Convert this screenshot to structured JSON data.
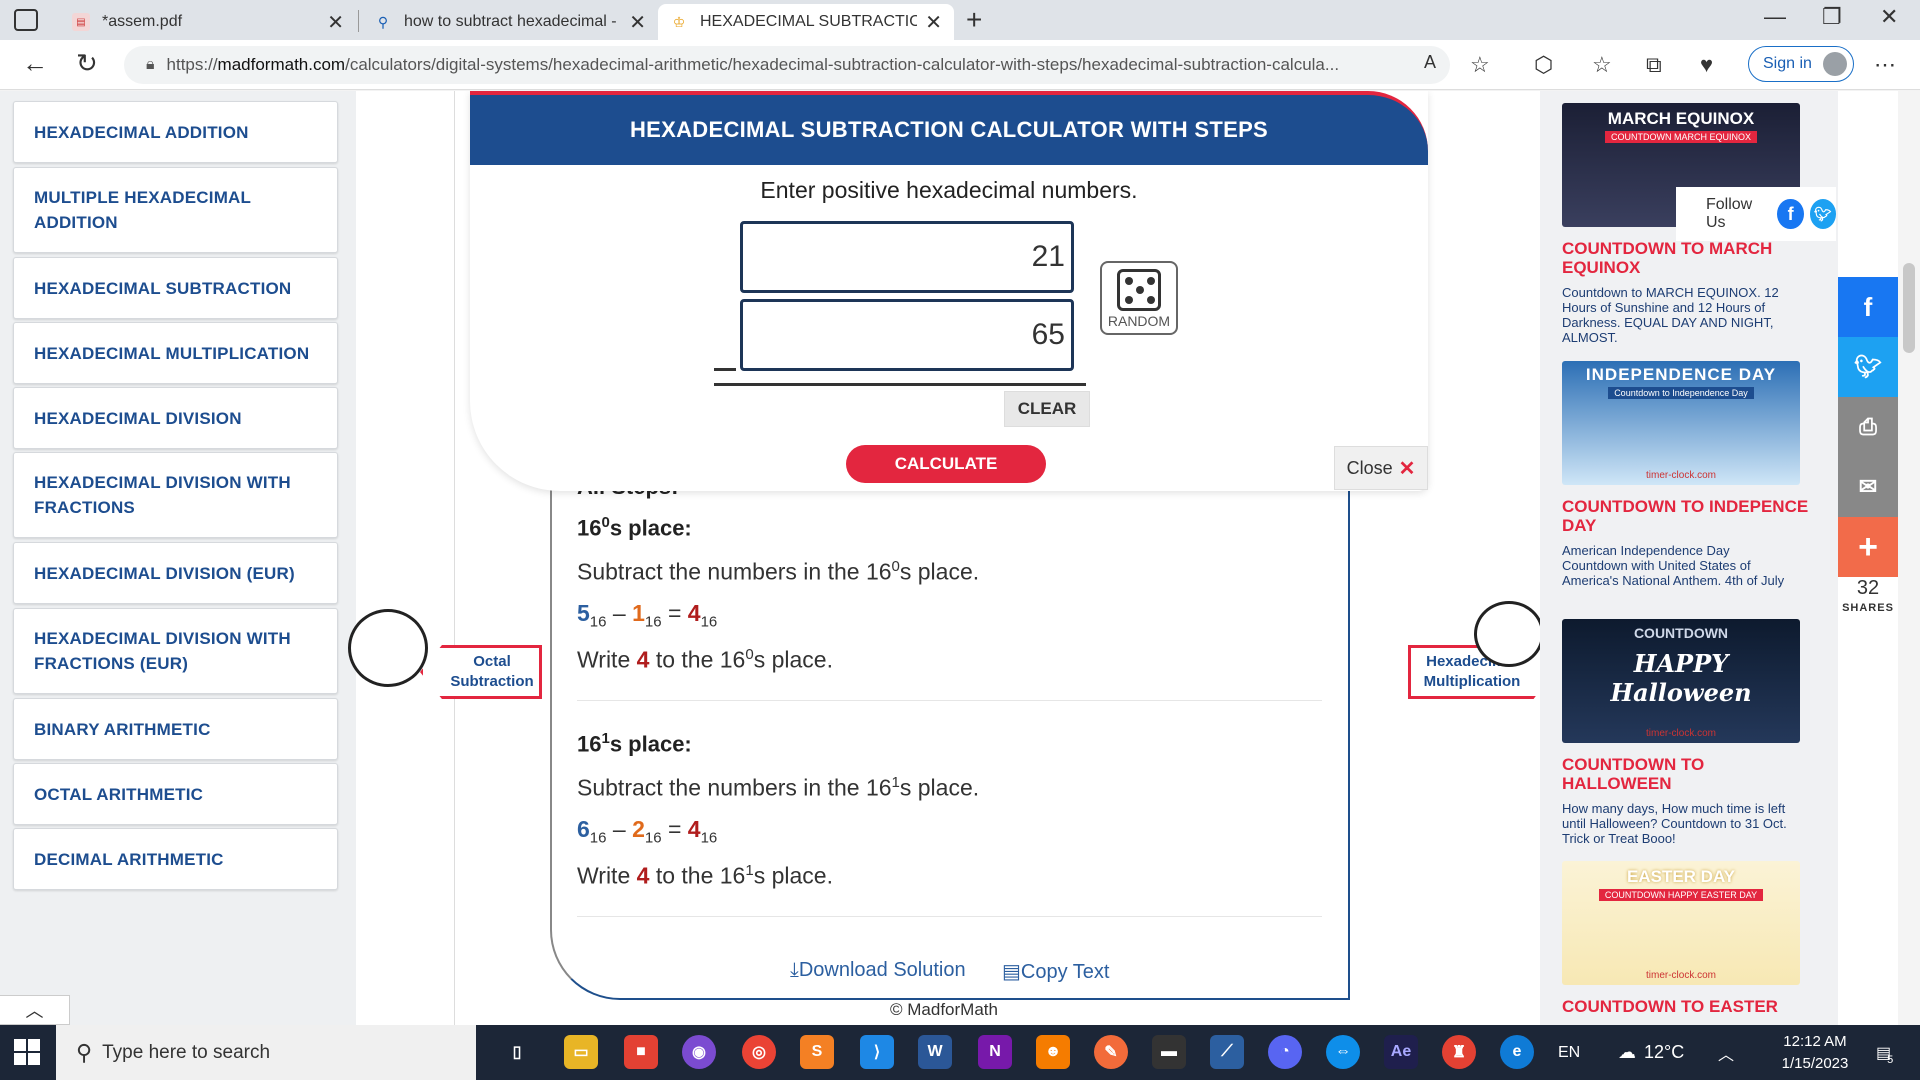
{
  "tabs": [
    {
      "title": "*assem.pdf",
      "icon": "pdf-icon"
    },
    {
      "title": "how to subtract hexadecimal - Se",
      "icon": "search-icon"
    },
    {
      "title": "HEXADECIMAL SUBTRACTION C/",
      "icon": "site-icon"
    }
  ],
  "address": {
    "prefix": "https://",
    "domain": "madformath.com",
    "path": "/calculators/digital-systems/hexadecimal-arithmetic/hexadecimal-subtraction-calculator-with-steps/hexadecimal-subtraction-calcula..."
  },
  "signin_label": "Sign in",
  "sidebar": {
    "items": [
      {
        "label": "HEXADECIMAL ADDITION"
      },
      {
        "label": "MULTIPLE HEXADECIMAL ADDITION"
      },
      {
        "label": "HEXADECIMAL SUBTRACTION"
      },
      {
        "label": "HEXADECIMAL MULTIPLICATION"
      },
      {
        "label": "HEXADECIMAL DIVISION"
      },
      {
        "label": "HEXADECIMAL DIVISION WITH FRACTIONS"
      },
      {
        "label": "HEXADECIMAL DIVISION (EUR)"
      },
      {
        "label": "HEXADECIMAL DIVISION WITH FRACTIONS (EUR)"
      },
      {
        "label": "BINARY ARITHMETIC"
      },
      {
        "label": "OCTAL ARITHMETIC"
      },
      {
        "label": "DECIMAL ARITHMETIC"
      }
    ]
  },
  "calculator": {
    "title": "HEXADECIMAL SUBTRACTION CALCULATOR WITH STEPS",
    "prompt": "Enter positive hexadecimal numbers.",
    "minuend": "21",
    "subtrahend": "65",
    "random_label": "RANDOM",
    "clear_label": "CLEAR",
    "calculate_label": "CALCULATE",
    "close_label": "Close"
  },
  "steps": {
    "partial_heading": "All Steps:",
    "places": [
      {
        "heading_base": "16",
        "exp": "0",
        "heading_tail": "s place:",
        "line1_pre": "Subtract the numbers in the 16",
        "line1_post": "s place.",
        "a": "5",
        "b": "1",
        "result": "4",
        "base": "16",
        "write_pre": "Write ",
        "write_digit": "4",
        "write_post_pre": " to the 16",
        "write_post": "s place."
      },
      {
        "heading_base": "16",
        "exp": "1",
        "heading_tail": "s place:",
        "line1_pre": "Subtract the numbers in the 16",
        "line1_post": "s place.",
        "a": "6",
        "b": "2",
        "result": "4",
        "base": "16",
        "write_pre": "Write ",
        "write_digit": "4",
        "write_post_pre": " to the 16",
        "write_post": "s place."
      }
    ],
    "minus_sign": "–",
    "equals_sign": "=",
    "download_label": "Download Solution",
    "copy_label": "Copy Text"
  },
  "mascots": {
    "left_label_1": "Octal",
    "left_label_2": "Subtraction",
    "right_label_1": "Hexadecimal",
    "right_label_2": "Multiplication"
  },
  "copyright": "© MadforMath",
  "follow_label": "Follow Us",
  "right_sidebar": {
    "ads": [
      {
        "title": "MARCH EQUINOX",
        "sub": "COUNTDOWN MARCH EQUINOX",
        "heading": "COUNTDOWN TO MARCH EQUINOX",
        "desc": "Countdown to MARCH EQUINOX. 12 Hours of Sunshine and 12 Hours of Darkness. EQUAL DAY AND NIGHT, ALMOST."
      },
      {
        "title": "INDEPENDENCE DAY",
        "sub": "Countdown to Independence Day",
        "foot": "timer-clock.com",
        "heading": "COUNTDOWN TO INDEPENCE DAY",
        "desc": "American Independence Day Countdown with United States of America's National Anthem. 4th of July"
      },
      {
        "title": "COUNTDOWN",
        "sub": "HAPPY Halloween",
        "foot": "timer-clock.com",
        "heading": "COUNTDOWN TO HALLOWEEN",
        "desc": "How many days, How much time is left until Halloween? Countdown to 31 Oct. Trick or Treat Booo!"
      },
      {
        "title": "EASTER DAY",
        "sub": "COUNTDOWN HAPPY EASTER DAY",
        "foot": "timer-clock.com",
        "heading": "COUNTDOWN TO EASTER",
        "desc": ""
      }
    ]
  },
  "share": {
    "count": "32",
    "label": "SHARES"
  },
  "taskbar": {
    "search_placeholder": "Type here to search",
    "lang": "EN",
    "temp": "12°C",
    "time": "12:12 AM",
    "date": "1/15/2023",
    "notif_count": "5"
  },
  "colors": {
    "brand_blue": "#1d4d8f",
    "brand_red": "#e3263f",
    "digit_blue": "#2c5fa0",
    "digit_orange": "#e06a1c",
    "digit_red": "#b01d1d"
  }
}
